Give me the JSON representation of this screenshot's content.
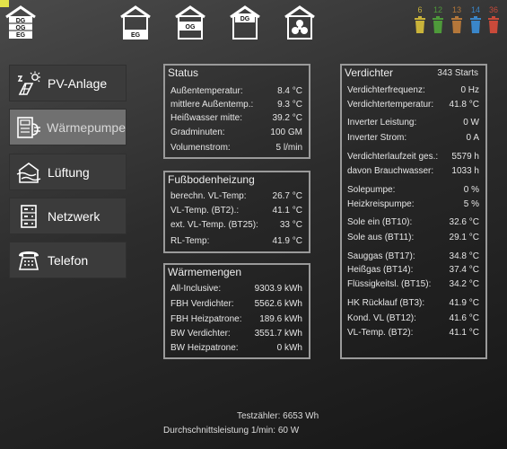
{
  "top_nav": {
    "houses": [
      {
        "name": "house-all-floors",
        "labels": [
          "DG",
          "OG",
          "EG"
        ]
      },
      {
        "name": "house-eg",
        "labels": [
          "EG"
        ]
      },
      {
        "name": "house-og",
        "labels": [
          "OG"
        ]
      },
      {
        "name": "house-dg",
        "labels": [
          "DG"
        ]
      },
      {
        "name": "house-fan",
        "labels": []
      }
    ],
    "trash_bins": [
      {
        "days": "6",
        "color": "#c9b33a"
      },
      {
        "days": "12",
        "color": "#4e9a3a"
      },
      {
        "days": "13",
        "color": "#b4773a"
      },
      {
        "days": "14",
        "color": "#3a86c9"
      },
      {
        "days": "36",
        "color": "#c94a3a"
      }
    ]
  },
  "sidebar": {
    "items": [
      {
        "label": "PV-Anlage",
        "icon": "solar-icon"
      },
      {
        "label": "Wärmepumpe",
        "icon": "heatpump-icon"
      },
      {
        "label": "Lüftung",
        "icon": "ventilation-icon"
      },
      {
        "label": "Netzwerk",
        "icon": "network-icon"
      },
      {
        "label": "Telefon",
        "icon": "phone-icon"
      }
    ]
  },
  "status": {
    "title": "Status",
    "rows": [
      {
        "label": "Außentemperatur:",
        "value": "8.4 °C"
      },
      {
        "label": "mittlere Außentemp.:",
        "value": "9.3 °C"
      },
      {
        "label": "Heißwasser mitte:",
        "value": "39.2 °C"
      },
      {
        "label": "Gradminuten:",
        "value": "100 GM"
      },
      {
        "label": "Volumenstrom:",
        "value": "5 l/min"
      }
    ]
  },
  "fussboden": {
    "title": "Fußbodenheizung",
    "rows": [
      {
        "label": "berechn. VL-Temp:",
        "value": "26.7 °C"
      },
      {
        "label": "VL-Temp. (BT2).:",
        "value": "41.1 °C"
      },
      {
        "label": "ext. VL-Temp. (BT25):",
        "value": "33 °C"
      },
      {
        "label": "RL-Temp:",
        "value": "41.9 °C"
      }
    ]
  },
  "waermemengen": {
    "title": "Wärmemengen",
    "rows": [
      {
        "label": "All-Inclusive:",
        "value": "9303.9 kWh"
      },
      {
        "label": "FBH Verdichter:",
        "value": "5562.6 kWh"
      },
      {
        "label": "FBH Heizpatrone:",
        "value": "189.6 kWh"
      },
      {
        "label": "BW Verdichter:",
        "value": "3551.7 kWh"
      },
      {
        "label": "BW Heizpatrone:",
        "value": "0 kWh"
      }
    ]
  },
  "verdichter": {
    "title": "Verdichter",
    "starts": "343 Starts",
    "rows": [
      {
        "label": "Verdichterfrequenz:",
        "value": "0 Hz"
      },
      {
        "label": "Verdichtertemperatur:",
        "value": "41.8 °C"
      },
      {
        "label": "Inverter Leistung:",
        "value": "0 W"
      },
      {
        "label": "Inverter Strom:",
        "value": "0 A"
      },
      {
        "label": "Verdichterlaufzeit ges.:",
        "value": "5579 h"
      },
      {
        "label": "davon Brauchwasser:",
        "value": "1033 h"
      },
      {
        "label": "Solepumpe:",
        "value": "0 %"
      },
      {
        "label": "Heizkreispumpe:",
        "value": "5 %"
      },
      {
        "label": "Sole ein (BT10):",
        "value": "32.6 °C"
      },
      {
        "label": "Sole aus (BT11):",
        "value": "29.1 °C"
      },
      {
        "label": "Sauggas (BT17):",
        "value": "34.8 °C"
      },
      {
        "label": "Heißgas (BT14):",
        "value": "37.4 °C"
      },
      {
        "label": "Flüssigkeitsl. (BT15):",
        "value": "34.2 °C"
      },
      {
        "label": "HK Rücklauf (BT3):",
        "value": "41.9 °C"
      },
      {
        "label": "Kond. VL (BT12):",
        "value": "41.6 °C"
      },
      {
        "label": "VL-Temp. (BT2):",
        "value": "41.1 °C"
      }
    ]
  },
  "footer": {
    "testzaehler": "Testzähler: 6653 Wh",
    "durchschnitt": "Durchschnittsleistung 1/min: 60 W"
  }
}
